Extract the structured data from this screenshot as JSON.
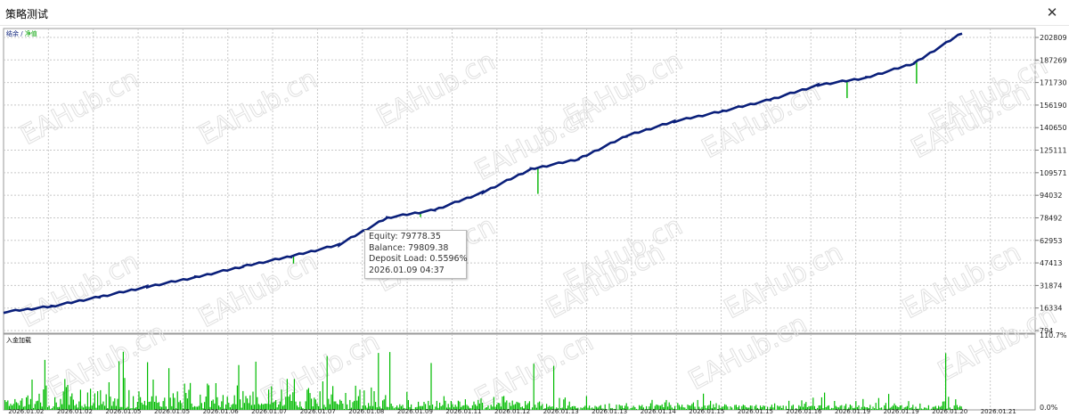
{
  "window": {
    "title": "策略测试",
    "close_label": "✕"
  },
  "top_legend": {
    "balance_label": "结余",
    "separator": " / ",
    "equity_label": "净值"
  },
  "bottom_legend": {
    "label": "入金加载"
  },
  "tooltip": {
    "equity": "Equity: 79778.35",
    "balance": "Balance: 79809.38",
    "deposit_load": "Deposit Load: 0.5596%",
    "time": "2026.01.09 04:37"
  },
  "watermark": "EAHub.cn",
  "colors": {
    "balance_line": "#0a1f7a",
    "equity_line": "#00b400",
    "deposit_bars": "#00bb00",
    "grid": "#c8c8c8",
    "background": "#ffffff"
  },
  "chart_data": [
    {
      "type": "line",
      "name": "balance-equity",
      "x": [
        "2026.01.02",
        "2026.01.02",
        "2026.01.05",
        "2026.01.05",
        "2026.01.06",
        "2026.01.07",
        "2026.01.07",
        "2026.01.08",
        "2026.01.09",
        "2026.01.11",
        "2026.01.12",
        "2026.01.13",
        "2026.01.13",
        "2026.01.14",
        "2026.01.15",
        "2026.01.15",
        "2026.01.16",
        "2026.01.19",
        "2026.01.19",
        "2026.01.20",
        "2026.01.21"
      ],
      "y_ticks": [
        "202809",
        "187269",
        "171730",
        "156190",
        "140650",
        "125111",
        "109571",
        "94032",
        "78492",
        "62953",
        "47413",
        "31874",
        "16334",
        "794"
      ],
      "ylim": [
        794,
        202809
      ],
      "series": [
        {
          "name": "结余",
          "values": [
            13500,
            17500,
            24000,
            31000,
            37500,
            45000,
            52000,
            60000,
            78500,
            84000,
            96000,
            112000,
            119000,
            135000,
            145000,
            152000,
            160000,
            170000,
            175000,
            185000,
            206000
          ]
        },
        {
          "name": "净值",
          "values": [
            13400,
            17300,
            23800,
            30800,
            37300,
            44800,
            51800,
            59800,
            78400,
            83800,
            95800,
            111800,
            118800,
            134800,
            144800,
            151800,
            159800,
            169800,
            174800,
            184800,
            205800
          ]
        }
      ],
      "equity_dips": [
        {
          "x": "2026.01.07",
          "value": 47000
        },
        {
          "x": "2026.01.09",
          "value": 79000
        },
        {
          "x": "2026.01.13",
          "value": 95000
        },
        {
          "x": "2026.01.19",
          "value": 161000
        },
        {
          "x": "2026.01.20",
          "value": 171000
        }
      ]
    },
    {
      "type": "bar",
      "name": "入金加载",
      "y_ticks": [
        "110.7%",
        "0.0%"
      ],
      "ylim": [
        0,
        110.7
      ]
    }
  ]
}
